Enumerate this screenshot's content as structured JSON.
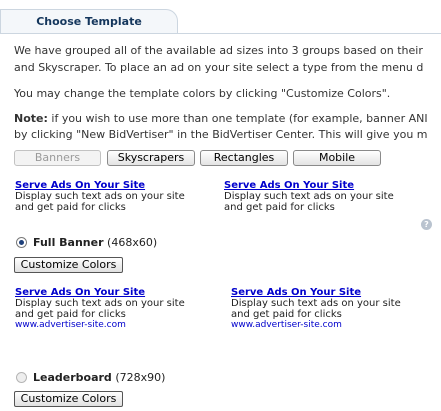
{
  "tab": {
    "label": "Choose Template"
  },
  "intro": {
    "line1": "We have grouped all of the available ad sizes into 3 groups based on their",
    "line2": "and Skyscraper. To place an ad on your site select a type from the menu d"
  },
  "colors_note": "You may change the template colors by clicking \"Customize Colors\".",
  "note": {
    "label": "Note:",
    "line1": " if you wish to use more than one template (for example, banner ANI",
    "line2": "by clicking \"New BidVertiser\" in the BidVertiser Center. This will give you m"
  },
  "type_buttons": {
    "banners": "Banners",
    "skyscrapers": "Skyscrapers",
    "rectangles": "Rectangles",
    "mobile": "Mobile"
  },
  "preview_top": [
    {
      "title": "Serve Ads On Your Site",
      "line1": "Display such text ads on your site",
      "line2": "and get paid for clicks"
    },
    {
      "title": "Serve Ads On Your Site",
      "line1": "Display such text ads on your site",
      "line2": "and get paid for clicks"
    }
  ],
  "help_icon": {
    "glyph": "?"
  },
  "full_banner": {
    "name": "Full Banner",
    "size": "(468x60)",
    "selected": true
  },
  "customize_label": "Customize Colors",
  "preview_full": [
    {
      "title": "Serve Ads On Your Site",
      "line1": "Display such text ads on your site",
      "line2": "and get paid for clicks",
      "url": "www.advertiser-site.com"
    },
    {
      "title": "Serve Ads On Your Site",
      "line1": "Display such text ads on your site",
      "line2": "and get paid for clicks",
      "url": "www.advertiser-site.com"
    }
  ],
  "leaderboard": {
    "name": "Leaderboard",
    "size": "(728x90)",
    "selected": false
  },
  "theme": {
    "link_color": "#0000cc",
    "tab_text_color": "#14365c"
  }
}
